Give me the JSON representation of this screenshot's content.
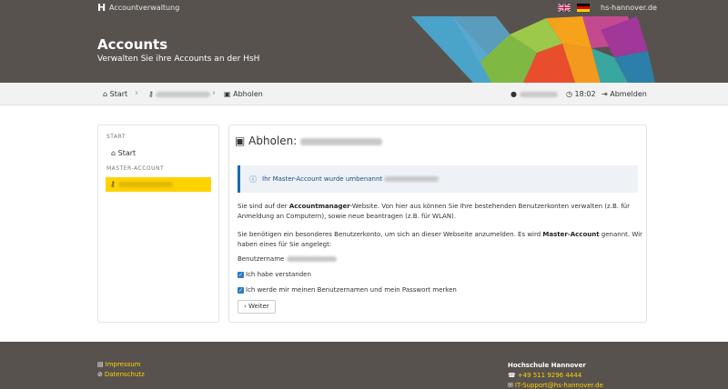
{
  "topbar": {
    "logo": "H",
    "app_name": "Accountverwaltung",
    "flags": [
      "english-flag",
      "german-flag"
    ],
    "domain": "hs-hannover.de"
  },
  "hero": {
    "title": "Accounts",
    "subtitle": "Verwalten Sie ihre Accounts an der HsH"
  },
  "breadcrumb": {
    "home": "Start",
    "current": "Abholen",
    "time": "18:02",
    "logout": "Abmelden"
  },
  "sidebar": {
    "section_start": "START",
    "start_link": "Start",
    "section_master": "MASTER-ACCOUNT"
  },
  "main": {
    "title": "Abholen:",
    "alert": "Ihr Master-Account wurde umbenannt",
    "para1_pre": "Sie sind auf der ",
    "para1_bold": "Accountmanager",
    "para1_post": "-Website. Von hier aus können Sie Ihre bestehenden Benutzerkonten verwalten (z.B. für Anmeldung an Computern), sowie neue beantragen (z.B. für WLAN).",
    "para2_pre": "Sie benötigen ein besonderes Benutzerkonto, um sich an dieser Webseite anzumelden. Es wird ",
    "para2_bold": "Master-Account",
    "para2_post": " genannt. Wir haben eines für Sie angelegt:",
    "username_label": "Benutzername",
    "check1": "Ich habe verstanden",
    "check2": "Ich werde mir meinen Benutzernamen und mein Passwort merken",
    "button": "Weiter"
  },
  "footer": {
    "impressum": "Impressum",
    "datenschutz": "Datenschutz",
    "org": "Hochschule Hannover",
    "phone": "+49 511 9296 4444",
    "email": "IT-Support@hs-hannover.de"
  },
  "colors": {
    "brand_dark": "#58524e",
    "accent_yellow": "#ffd200",
    "link_blue": "#1a6bb5"
  }
}
